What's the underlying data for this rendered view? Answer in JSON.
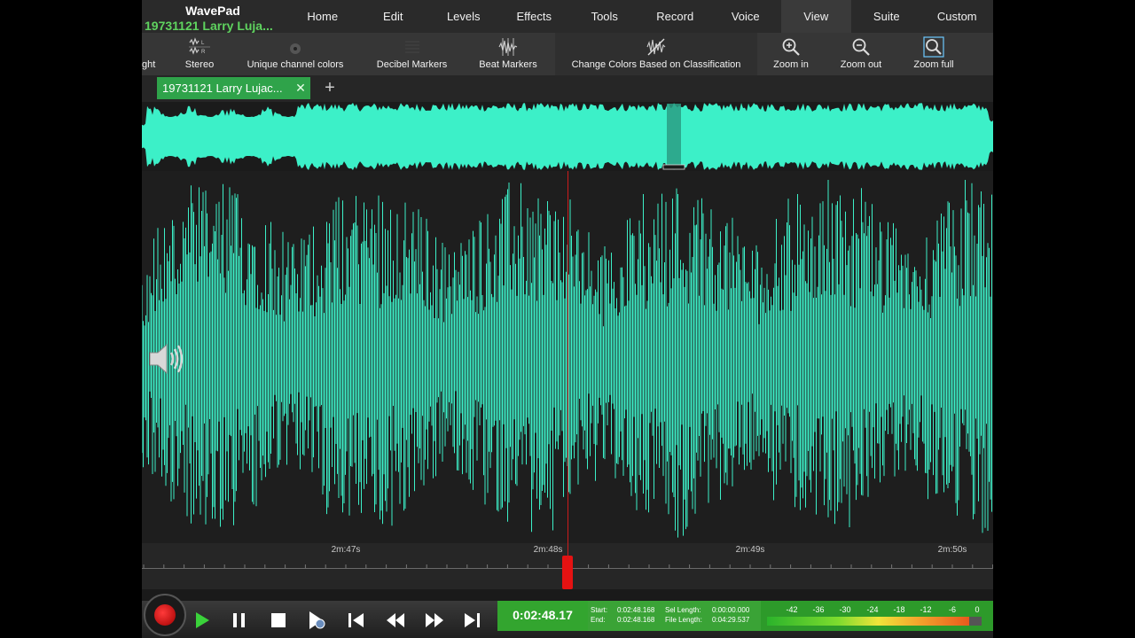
{
  "app": {
    "name": "WavePad",
    "file_short": "19731121 Larry Luja..."
  },
  "menu": [
    "Home",
    "Edit",
    "Levels",
    "Effects",
    "Tools",
    "Record",
    "Voice",
    "View",
    "Suite",
    "Custom"
  ],
  "menu_active": "View",
  "toolbar": {
    "truncated_left": "ght",
    "stereo": "Stereo",
    "unique_colors": "Unique channel colors",
    "decibel": "Decibel Markers",
    "beat": "Beat Markers",
    "change_colors": "Change Colors Based on Classification",
    "zoom_in": "Zoom in",
    "zoom_out": "Zoom out",
    "zoom_full": "Zoom full"
  },
  "tab": {
    "label": "19731121 Larry Lujac...",
    "close": "✕",
    "add": "+"
  },
  "ruler": {
    "labels": [
      "2m:47s",
      "2m:48s",
      "2m:49s",
      "2m:50s"
    ]
  },
  "transport": {
    "time": "0:02:48.17",
    "start_label": "Start:",
    "start": "0:02:48.168",
    "end_label": "End:",
    "end": "0:02:48.168",
    "sel_length_label": "Sel Length:",
    "sel_length": "0:00:00.000",
    "file_length_label": "File Length:",
    "file_length": "0:04:29.537"
  },
  "meter": {
    "labels": [
      "-42",
      "-36",
      "-30",
      "-24",
      "-18",
      "-12",
      "-6",
      "0"
    ]
  },
  "colors": {
    "waveform": "#3cf0c8",
    "playhead": "#cc1c1c",
    "accent_green": "#33a52f"
  }
}
